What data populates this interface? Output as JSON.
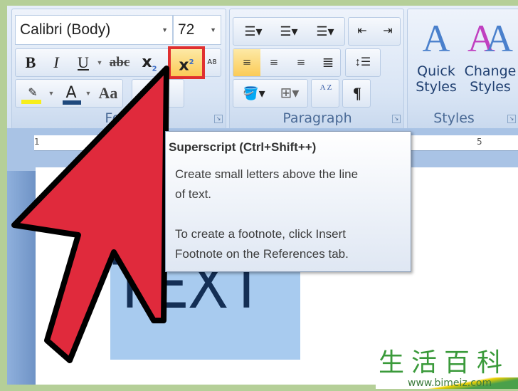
{
  "font_group": {
    "font_name": "Calibri (Body)",
    "font_size": "72",
    "bold": "B",
    "italic": "I",
    "underline": "U",
    "strikethrough": "abc",
    "subscript": "x",
    "superscript": "x",
    "clear_format": "A8",
    "font_color": "A",
    "change_case": "Aa",
    "label": "Font"
  },
  "paragraph_group": {
    "label": "Paragraph",
    "pilcrow": "¶",
    "sort": "A Z"
  },
  "styles_group": {
    "quick": "Quick",
    "quick2": "Styles",
    "change": "Change",
    "change2": "Styles",
    "label": "Styles"
  },
  "ruler": {
    "left": "1",
    "right": "5"
  },
  "tooltip": {
    "title": "Superscript (Ctrl+Shift++)",
    "line1": "Create small letters above the line",
    "line2": "of text.",
    "line3": "To create a footnote, click Insert",
    "line4": "Footnote on the References tab."
  },
  "document": {
    "text": "TEXT"
  },
  "watermark": {
    "chars": "生活百科",
    "url": "www.bimeiz.com"
  },
  "colors": {
    "highlight": "#f7ee1c",
    "font_color": "#1f497d",
    "arrow": "#e02a3c",
    "selection": "#a8cbef"
  }
}
